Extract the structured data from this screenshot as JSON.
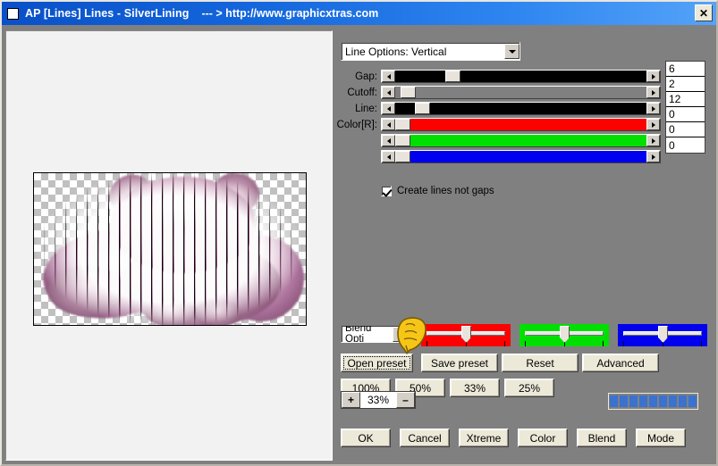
{
  "window": {
    "icon": "window-icon",
    "title": "AP [Lines]  Lines - SilverLining",
    "url_text": "--- > http://www.graphicxtras.com",
    "close_label": "✕",
    "titlebar_color": "#0a50c8",
    "panel_bg": "#808080"
  },
  "preview": {
    "name": "filter-preview",
    "description": "Pink tinted cat image with vertical line filter over transparency checkerboard"
  },
  "options": {
    "line_options_label": "Line Options: Vertical"
  },
  "sliders": [
    {
      "label": "Gap:",
      "value": "6",
      "track": "black",
      "thumb_pct": 20
    },
    {
      "label": "Cutoff:",
      "value": "2",
      "track": "gray",
      "thumb_pct": 2
    },
    {
      "label": "Line:",
      "value": "12",
      "track": "black",
      "thumb_pct": 8
    },
    {
      "label": "Color[R]:",
      "value": "0",
      "track": "red",
      "thumb_pct": 0
    },
    {
      "label": "",
      "value": "0",
      "track": "green",
      "thumb_pct": 0
    },
    {
      "label": "",
      "value": "0",
      "track": "blue",
      "thumb_pct": 0
    }
  ],
  "checkbox": {
    "label": "Create lines not gaps",
    "checked": true
  },
  "blend": {
    "combo_label": "Blend Opti",
    "channels": [
      {
        "name": "red",
        "color": "#ff0000",
        "knob_pct": 50
      },
      {
        "name": "green",
        "color": "#00e000",
        "knob_pct": 50
      },
      {
        "name": "blue",
        "color": "#0000ee",
        "knob_pct": 50
      }
    ]
  },
  "cursor": {
    "name": "pointing-hand-cursor",
    "color": "#f5c518"
  },
  "preset_buttons": [
    {
      "label": "Open preset",
      "name": "open-preset-button",
      "focused": true
    },
    {
      "label": "Save preset",
      "name": "save-preset-button",
      "focused": false
    },
    {
      "label": "Reset",
      "name": "reset-button",
      "focused": false
    },
    {
      "label": "Advanced",
      "name": "advanced-button",
      "focused": false
    }
  ],
  "zoom_buttons": [
    {
      "label": "100%",
      "name": "zoom-100-button"
    },
    {
      "label": "50%",
      "name": "zoom-50-button"
    },
    {
      "label": "33%",
      "name": "zoom-33-button"
    },
    {
      "label": "25%",
      "name": "zoom-25-button"
    }
  ],
  "zoom_stepper": {
    "plus": "+",
    "value": "33%",
    "minus": "–"
  },
  "progress": {
    "blocks": 9,
    "color": "#3a72d0"
  },
  "action_buttons": [
    {
      "label": "OK",
      "accel": "O",
      "name": "ok-button"
    },
    {
      "label": "Cancel",
      "accel": "C",
      "name": "cancel-button"
    },
    {
      "label": "Xtreme",
      "accel": "X",
      "name": "xtreme-button"
    },
    {
      "label": "Color",
      "accel": "C",
      "name": "color-button"
    },
    {
      "label": "Blend",
      "accel": "B",
      "name": "blend-button"
    },
    {
      "label": "Mode",
      "accel": "M",
      "name": "mode-button"
    }
  ]
}
